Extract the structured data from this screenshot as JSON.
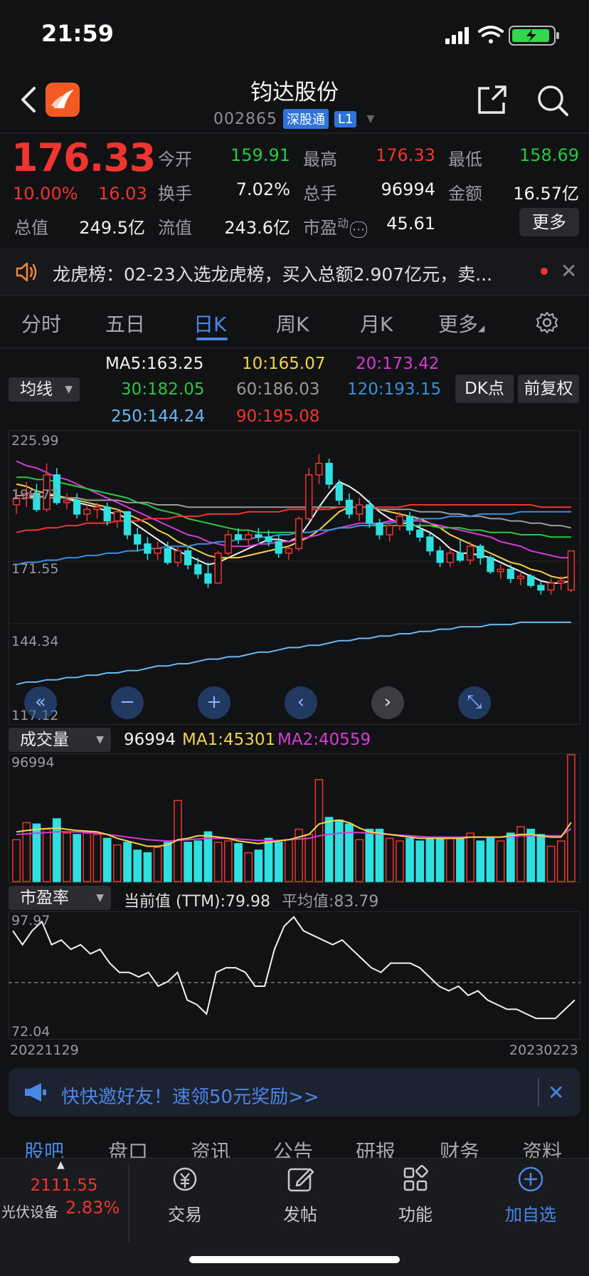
{
  "status_bar": {
    "time": "21:59"
  },
  "header": {
    "stock_name": "钧达股份",
    "stock_code": "002865",
    "badge_connect": "深股通",
    "badge_level": "L1"
  },
  "quote": {
    "price": "176.33",
    "change_pct": "10.00%",
    "change": "16.03",
    "fields": [
      {
        "label": "今开",
        "value": "159.91",
        "color": "green"
      },
      {
        "label": "最高",
        "value": "176.33",
        "color": "red"
      },
      {
        "label": "最低",
        "value": "158.69",
        "color": "green"
      },
      {
        "label": "换手",
        "value": "7.02%",
        "color": "white"
      },
      {
        "label": "总手",
        "value": "96994",
        "color": "white"
      },
      {
        "label": "金额",
        "value": "16.57亿",
        "color": "white"
      },
      {
        "label": "总值",
        "value": "249.5亿",
        "color": "white"
      },
      {
        "label": "流值",
        "value": "243.6亿",
        "color": "white"
      },
      {
        "label": "市盈",
        "value": "45.61",
        "color": "white"
      }
    ],
    "pe_sup": "动",
    "more_label": "更多"
  },
  "notice": {
    "text": "龙虎榜：02-23入选龙虎榜，买入总额2.907亿元，卖..."
  },
  "chart_tabs": [
    "分时",
    "五日",
    "日K",
    "周K",
    "月K",
    "更多"
  ],
  "ma_panel": {
    "selector": "均线",
    "dk_label": "DK点",
    "adjust_label": "前复权",
    "items": [
      {
        "text": "MA5:163.25",
        "color": "#f2f2f2"
      },
      {
        "text": "10:165.07",
        "color": "#f2d34a"
      },
      {
        "text": "20:173.42",
        "color": "#d63bd6"
      },
      {
        "text": "30:182.05",
        "color": "#27c93f"
      },
      {
        "text": "60:186.03",
        "color": "#9a9a9a"
      },
      {
        "text": "120:193.15",
        "color": "#3a8de0"
      },
      {
        "text": "250:144.24",
        "color": "#6ab8f0"
      },
      {
        "text": "90:195.08",
        "color": "#f0342f"
      }
    ]
  },
  "chart_data": [
    {
      "type": "candlestick",
      "ylabels": [
        "225.99",
        "198.77",
        "171.55",
        "144.34",
        "117.12"
      ],
      "ylim": [
        117.12,
        225.99
      ],
      "candles": [
        [
          196,
          203,
          192,
          199
        ],
        [
          199,
          206,
          195,
          201
        ],
        [
          201,
          205,
          193,
          194
        ],
        [
          194,
          214,
          193,
          209
        ],
        [
          209,
          212,
          196,
          197
        ],
        [
          197,
          201,
          194,
          198
        ],
        [
          198,
          201,
          190,
          192
        ],
        [
          192,
          196,
          189,
          194
        ],
        [
          194,
          197,
          190,
          195
        ],
        [
          195,
          197,
          187,
          189
        ],
        [
          189,
          194,
          186,
          193
        ],
        [
          193,
          193,
          181,
          183
        ],
        [
          183,
          186,
          176,
          179
        ],
        [
          179,
          182,
          172,
          175
        ],
        [
          175,
          180,
          172,
          177
        ],
        [
          177,
          180,
          170,
          171
        ],
        [
          171,
          178,
          169,
          176
        ],
        [
          176,
          178,
          168,
          170
        ],
        [
          170,
          173,
          164,
          166
        ],
        [
          166,
          171,
          160,
          162
        ],
        [
          162,
          176,
          162,
          175
        ],
        [
          175,
          185,
          174,
          183
        ],
        [
          183,
          186,
          179,
          181
        ],
        [
          181,
          185,
          178,
          183
        ],
        [
          183,
          186,
          180,
          182
        ],
        [
          182,
          185,
          178,
          180
        ],
        [
          180,
          183,
          173,
          175
        ],
        [
          175,
          178,
          172,
          177
        ],
        [
          177,
          191,
          176,
          190
        ],
        [
          190,
          212,
          189,
          209
        ],
        [
          209,
          218,
          205,
          214
        ],
        [
          214,
          216,
          203,
          205
        ],
        [
          205,
          207,
          196,
          198
        ],
        [
          198,
          201,
          190,
          192
        ],
        [
          192,
          199,
          189,
          196
        ],
        [
          196,
          198,
          186,
          188
        ],
        [
          188,
          190,
          181,
          183
        ],
        [
          183,
          189,
          180,
          187
        ],
        [
          187,
          193,
          185,
          191
        ],
        [
          191,
          193,
          183,
          185
        ],
        [
          185,
          188,
          180,
          182
        ],
        [
          182,
          184,
          174,
          176
        ],
        [
          176,
          178,
          169,
          171
        ],
        [
          171,
          177,
          169,
          175
        ],
        [
          175,
          181,
          171,
          172
        ],
        [
          172,
          180,
          170,
          178
        ],
        [
          178,
          179,
          170,
          173
        ],
        [
          173,
          174,
          166,
          167
        ],
        [
          167,
          170,
          164,
          168
        ],
        [
          168,
          170,
          162,
          164
        ],
        [
          164,
          167,
          161,
          165
        ],
        [
          165,
          166,
          160,
          161
        ],
        [
          161,
          163,
          157,
          159
        ],
        [
          159,
          164,
          157,
          162
        ],
        [
          162,
          165,
          159,
          163
        ],
        [
          159,
          176,
          158,
          176
        ]
      ],
      "ma_lines": {
        "MA5": [
          200,
          200,
          199,
          200,
          200,
          199,
          197,
          196,
          195,
          193,
          192,
          190,
          187,
          184,
          181,
          178,
          176,
          174,
          172,
          170,
          171,
          173,
          175,
          177,
          179,
          181,
          181,
          180,
          182,
          188,
          195,
          201,
          206,
          204,
          201,
          197,
          193,
          190,
          188,
          188,
          186,
          184,
          181,
          177,
          175,
          175,
          174,
          173,
          171,
          169,
          167,
          165,
          163,
          162,
          162,
          163
        ],
        "MA10": [
          205,
          204,
          202,
          201,
          200,
          199,
          198,
          197,
          196,
          195,
          194,
          192,
          190,
          188,
          185,
          183,
          180,
          178,
          176,
          174,
          173,
          173,
          173,
          174,
          175,
          176,
          177,
          178,
          180,
          182,
          185,
          189,
          193,
          195,
          195,
          195,
          194,
          193,
          192,
          191,
          190,
          188,
          186,
          183,
          181,
          179,
          177,
          175,
          173,
          171,
          170,
          168,
          167,
          165,
          164,
          165
        ],
        "MA20": [
          215,
          213,
          212,
          210,
          208,
          207,
          205,
          203,
          201,
          199,
          197,
          195,
          193,
          191,
          189,
          187,
          185,
          183,
          182,
          180,
          179,
          178,
          178,
          178,
          179,
          179,
          180,
          180,
          181,
          182,
          183,
          185,
          186,
          187,
          188,
          188,
          188,
          189,
          189,
          189,
          189,
          188,
          187,
          186,
          185,
          184,
          183,
          182,
          180,
          179,
          178,
          176,
          175,
          174,
          173,
          173
        ],
        "MA30": [
          208,
          208,
          207,
          207,
          206,
          205,
          204,
          203,
          202,
          201,
          200,
          199,
          197,
          196,
          194,
          193,
          192,
          190,
          189,
          188,
          187,
          186,
          185,
          185,
          184,
          184,
          184,
          184,
          184,
          184,
          185,
          185,
          186,
          186,
          187,
          187,
          187,
          187,
          187,
          187,
          187,
          187,
          186,
          186,
          186,
          185,
          185,
          184,
          184,
          184,
          183,
          183,
          183,
          182,
          182,
          182
        ],
        "MA60": [
          200,
          200,
          200,
          199,
          199,
          199,
          199,
          198,
          198,
          198,
          198,
          197,
          197,
          197,
          196,
          196,
          196,
          195,
          195,
          195,
          195,
          195,
          195,
          195,
          195,
          195,
          195,
          195,
          195,
          195,
          195,
          195,
          195,
          195,
          195,
          195,
          194,
          194,
          194,
          194,
          193,
          193,
          193,
          192,
          192,
          191,
          191,
          190,
          190,
          189,
          189,
          188,
          188,
          187,
          187,
          186
        ],
        "MA90": [
          184,
          185,
          185,
          186,
          186,
          187,
          187,
          188,
          188,
          188,
          189,
          189,
          189,
          190,
          190,
          190,
          191,
          191,
          191,
          192,
          192,
          192,
          192,
          193,
          193,
          193,
          193,
          194,
          194,
          194,
          194,
          194,
          195,
          195,
          195,
          195,
          195,
          195,
          195,
          196,
          196,
          196,
          196,
          196,
          196,
          196,
          196,
          196,
          196,
          196,
          196,
          196,
          195,
          195,
          195,
          195
        ],
        "MA120": [
          170,
          171,
          171,
          172,
          172,
          173,
          173,
          174,
          174,
          175,
          175,
          176,
          176,
          177,
          177,
          178,
          178,
          178,
          179,
          179,
          180,
          180,
          181,
          181,
          182,
          182,
          183,
          183,
          184,
          184,
          185,
          185,
          186,
          186,
          187,
          187,
          188,
          188,
          189,
          189,
          190,
          190,
          190,
          191,
          191,
          191,
          192,
          192,
          192,
          192,
          193,
          193,
          193,
          193,
          193,
          193
        ],
        "MA250": [
          118,
          119,
          119,
          120,
          120,
          121,
          121,
          122,
          122,
          123,
          123,
          124,
          124,
          125,
          126,
          126,
          127,
          127,
          128,
          129,
          129,
          130,
          130,
          131,
          132,
          132,
          133,
          134,
          134,
          135,
          135,
          136,
          137,
          137,
          138,
          138,
          139,
          139,
          140,
          140,
          141,
          141,
          142,
          142,
          143,
          143,
          143,
          144,
          144,
          144,
          145,
          145,
          145,
          145,
          145,
          145
        ]
      }
    },
    {
      "type": "bar",
      "selector": "成交量",
      "values_label": "96994",
      "ma1_label": "MA1:45301",
      "ma2_label": "MA2:40559",
      "ylabel": "96994",
      "ylim": [
        0,
        96994
      ],
      "values": [
        32000,
        45000,
        44000,
        40000,
        48000,
        37000,
        36000,
        37000,
        36000,
        33000,
        28000,
        30000,
        24000,
        22000,
        26000,
        30000,
        62000,
        30000,
        31000,
        38000,
        30000,
        31000,
        29000,
        22000,
        24000,
        33000,
        30000,
        32000,
        40000,
        36000,
        78000,
        49000,
        47000,
        44000,
        32000,
        40000,
        40000,
        33000,
        31000,
        33000,
        31000,
        33000,
        33000,
        33000,
        33000,
        37000,
        31000,
        33000,
        31000,
        37000,
        42000,
        40000,
        36000,
        27000,
        31000,
        96994
      ],
      "ma1": [
        38000,
        39000,
        40000,
        40500,
        41000,
        40000,
        39000,
        38500,
        38000,
        36000,
        33000,
        31000,
        29000,
        27000,
        27000,
        28000,
        32000,
        33000,
        35000,
        35000,
        34000,
        33000,
        31000,
        30000,
        29000,
        30000,
        31000,
        32000,
        34000,
        36000,
        44000,
        46000,
        47000,
        45000,
        41000,
        38000,
        37000,
        36000,
        35000,
        34000,
        33000,
        33000,
        33000,
        33000,
        33000,
        34000,
        34000,
        34000,
        34000,
        35000,
        36000,
        36000,
        35000,
        34000,
        34000,
        45301
      ],
      "ma2": [
        36000,
        36500,
        37000,
        37500,
        38000,
        38000,
        38000,
        37500,
        37000,
        36000,
        35000,
        34000,
        33000,
        32000,
        31500,
        31000,
        31500,
        32000,
        32500,
        33000,
        33000,
        33000,
        32500,
        32000,
        31500,
        31500,
        31500,
        32000,
        32500,
        33000,
        35000,
        36000,
        37000,
        37500,
        37500,
        37000,
        36500,
        36000,
        35500,
        35000,
        34500,
        34000,
        34000,
        34000,
        34000,
        34000,
        34000,
        34000,
        34000,
        34500,
        35000,
        35000,
        35000,
        35000,
        35000,
        40559
      ]
    },
    {
      "type": "line",
      "selector": "市盈率",
      "current_label": "当前值 (TTM):79.98",
      "avg_label": "平均值:83.79",
      "ylabels": [
        "97.97",
        "72.04"
      ],
      "ylim": [
        72.04,
        97.97
      ],
      "avg": 83.79,
      "x_start": "20221129",
      "x_end": "20230223",
      "values": [
        95,
        92,
        95,
        97,
        92,
        93,
        91,
        92,
        90,
        91,
        88,
        86,
        86,
        85,
        86,
        83,
        84,
        86,
        80,
        79,
        77,
        86,
        87,
        87,
        86,
        83,
        83,
        91,
        96,
        98,
        95,
        94,
        93,
        92,
        93,
        91,
        89,
        87,
        86,
        88,
        88,
        88,
        87,
        85,
        83,
        82,
        83,
        81,
        82,
        80,
        79,
        78,
        78,
        77,
        76,
        76,
        76,
        78,
        80
      ]
    }
  ],
  "invite": {
    "text": "快快邀好友！速领50元奖励>>"
  },
  "bottom_tabs": [
    "股吧",
    "盘口",
    "资讯",
    "公告",
    "研报",
    "财务",
    "资料"
  ],
  "bottom_bar": {
    "index_value": "2111.55",
    "index_name": "光伏设备",
    "index_pct": "2.83%",
    "items": [
      "交易",
      "发帖",
      "功能",
      "加自选"
    ]
  },
  "colors": {
    "up": "#f0342f",
    "down": "#2fe0e0",
    "accent": "#4a86e8"
  }
}
